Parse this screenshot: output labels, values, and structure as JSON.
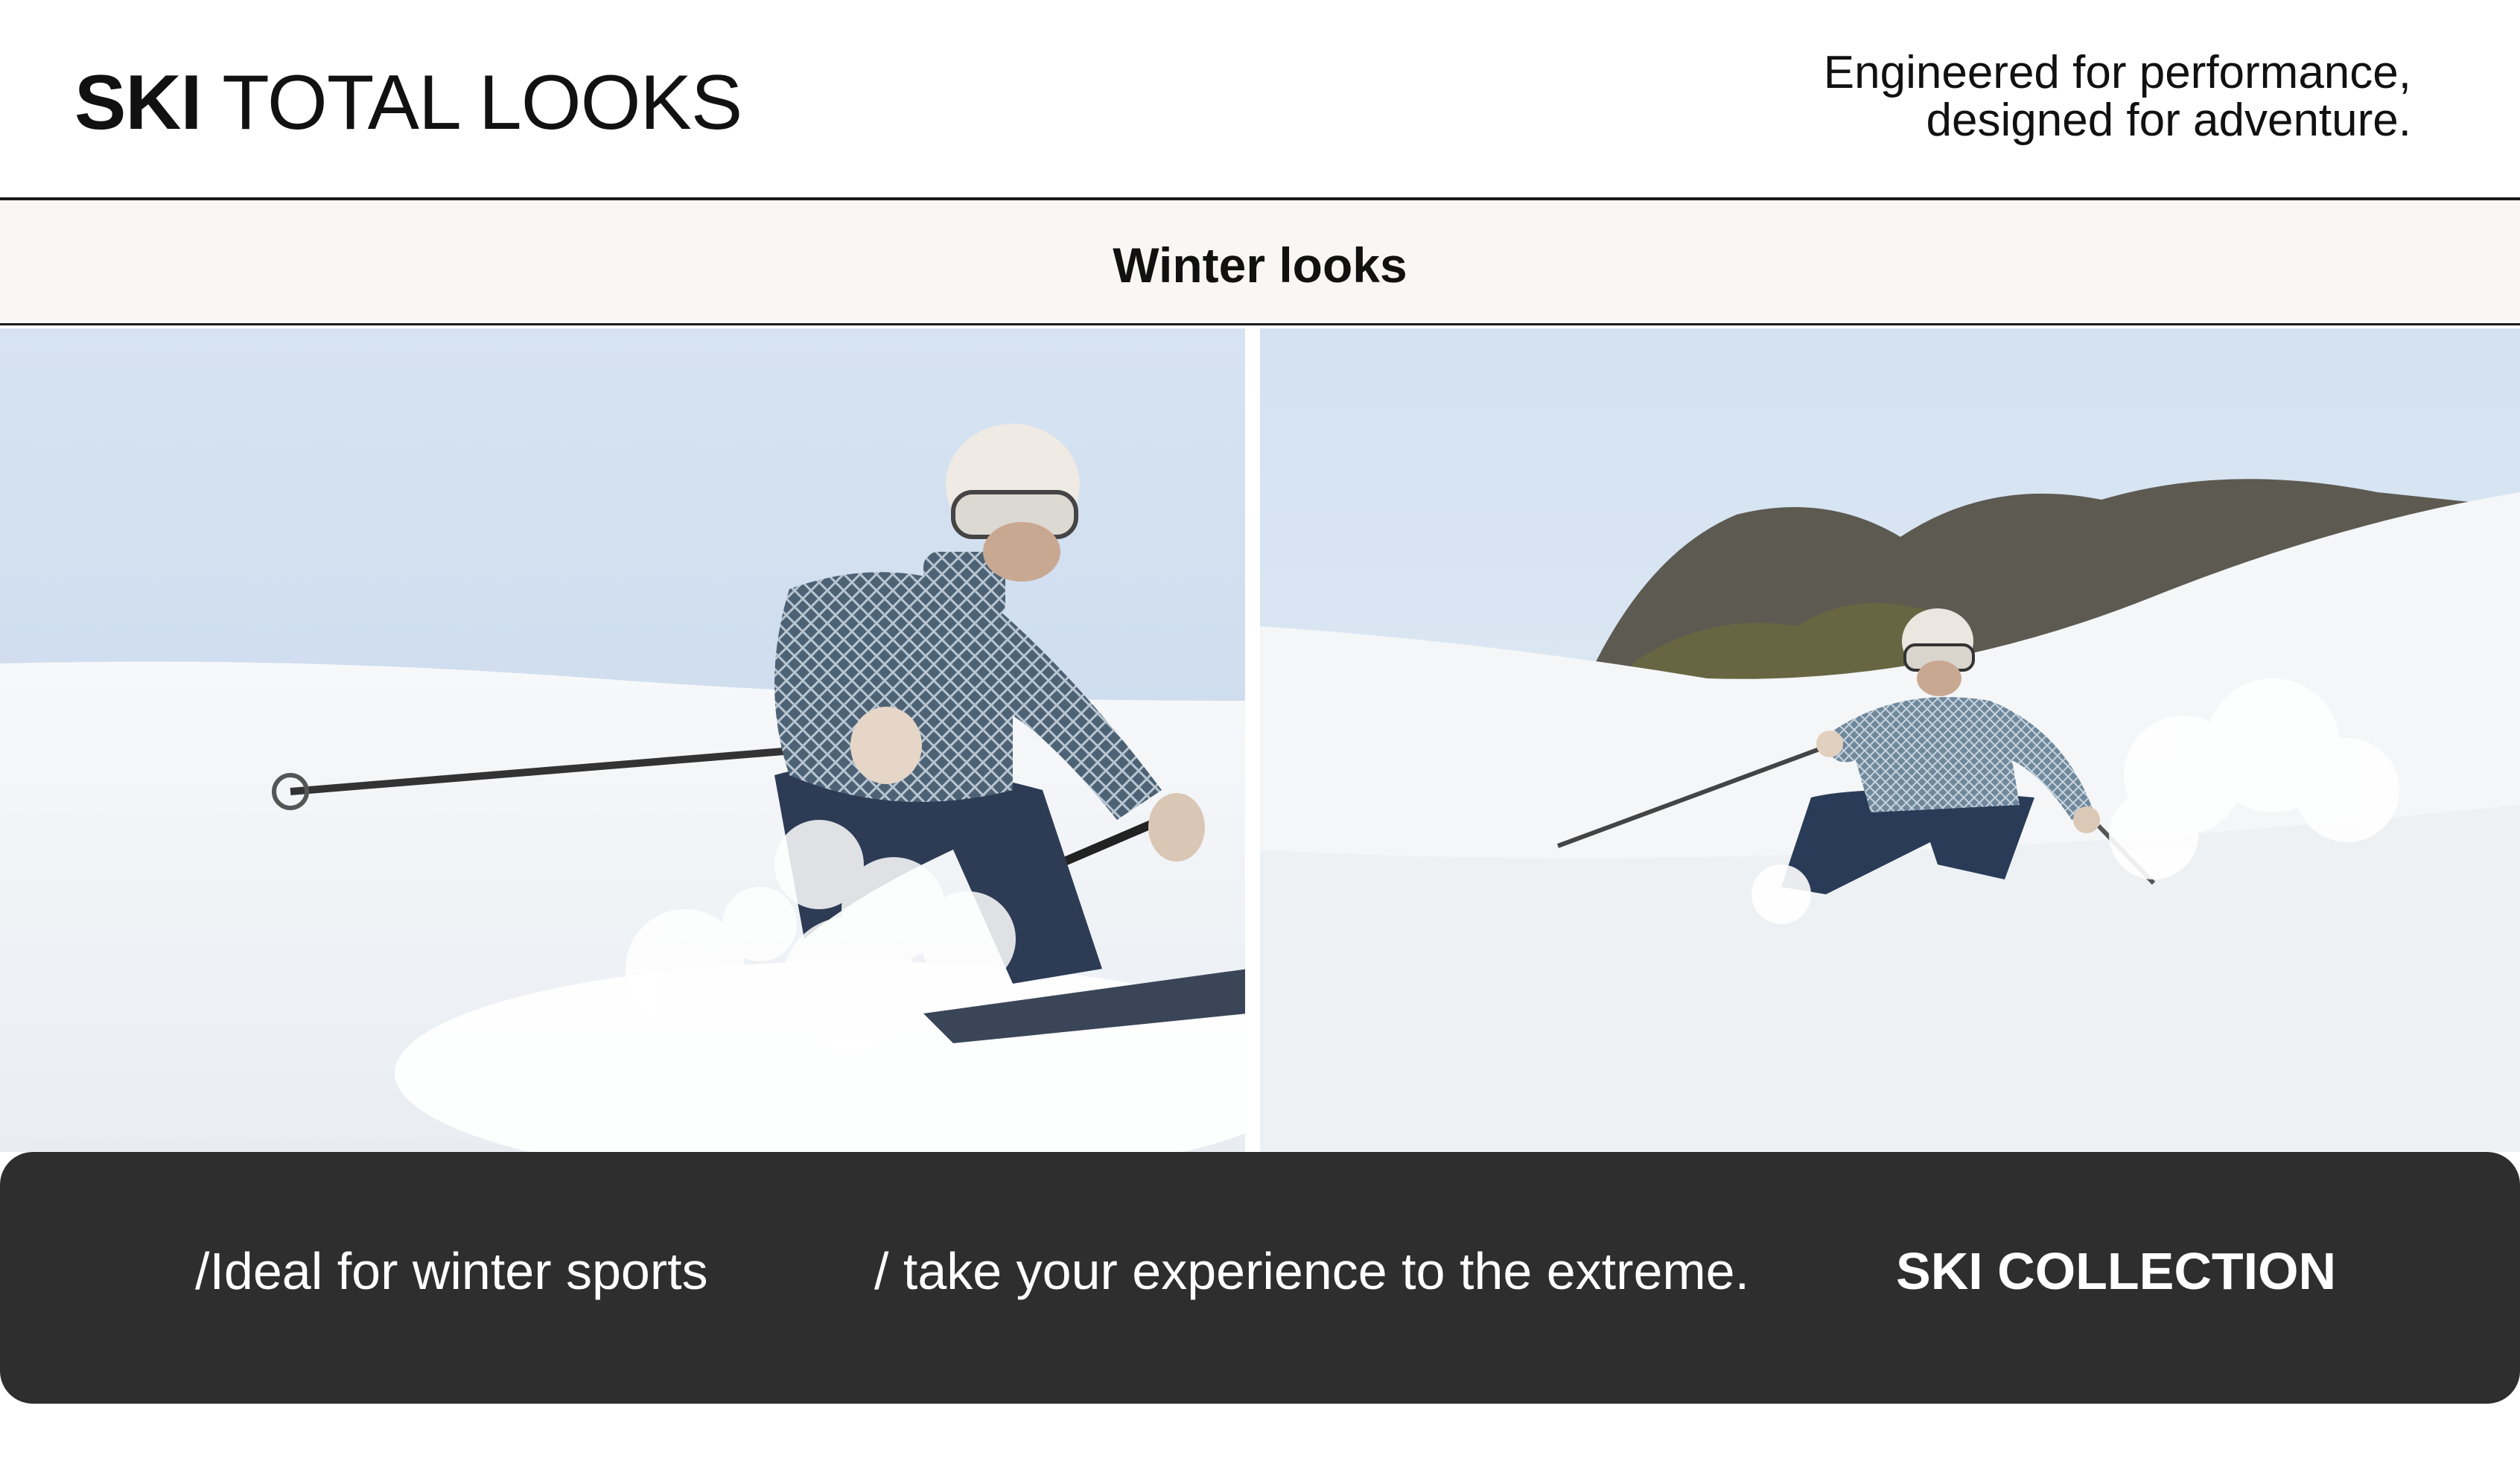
{
  "header": {
    "title_bold": "SKI",
    "title_light": "TOTAL LOOKS",
    "tagline_line1": "Engineered for performance,",
    "tagline_line2": "designed for adventure."
  },
  "section": {
    "title": "Winter looks"
  },
  "images": [
    {
      "subject": "skier-closeup"
    },
    {
      "subject": "skier-on-slope"
    }
  ],
  "footer": {
    "item1": "/Ideal for winter sports",
    "item2": "/ take your experience to the extreme.",
    "cta": "SKI COLLECTION"
  },
  "colors": {
    "panel": "#2e2e2e",
    "subbar": "#f8f7f5",
    "sky": "#d3e0ee",
    "snow": "#f3f5f7",
    "jacket": "#4a5f72",
    "pants": "#2c3a52"
  }
}
